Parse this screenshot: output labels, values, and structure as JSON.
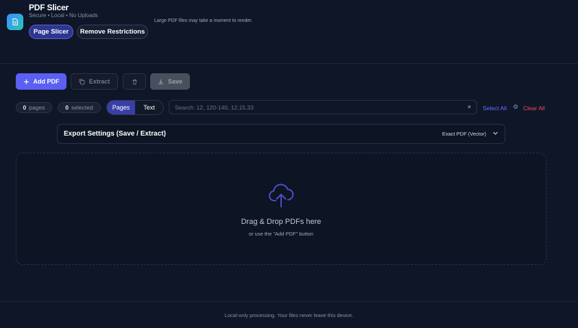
{
  "header": {
    "title": "PDF Slicer",
    "subtitle": "Secure • Local • No Uploads",
    "nav": [
      {
        "label": "Page Slicer",
        "active": true
      },
      {
        "label": "Remove Restrictions",
        "active": false
      }
    ],
    "hint": "Large PDF files may take a moment to render."
  },
  "toolbar": {
    "add_label": "Add PDF",
    "extract_label": "Extract",
    "save_label": "Save"
  },
  "filters": {
    "pages_count": "0",
    "pages_label": "pages",
    "selected_count": "0",
    "selected_label": "selected",
    "mode_pages": "Pages",
    "mode_text": "Text",
    "search_placeholder": "Search: 12, 120-140, 12,15,33",
    "search_value": "",
    "clear_glyph": "×",
    "select_all": "Select All",
    "clear_all": "Clear All"
  },
  "export": {
    "title": "Export Settings (Save / Extract)",
    "mode": "Exact PDF (Vector)"
  },
  "dropzone": {
    "title": "Drag & Drop PDFs here",
    "subtitle": "or use the \"Add PDF\" button"
  },
  "footer": {
    "text": "Local-only processing. Your files never leave this device."
  },
  "colors": {
    "background": "#0e1628",
    "accent": "#5b5ff2",
    "danger": "#f04b59",
    "link": "#6a70ff"
  },
  "icons": [
    "file-icon",
    "plus-icon",
    "copy-icon",
    "trash-icon",
    "download-icon",
    "gear-icon",
    "chevron-down-icon",
    "cloud-upload-icon"
  ]
}
